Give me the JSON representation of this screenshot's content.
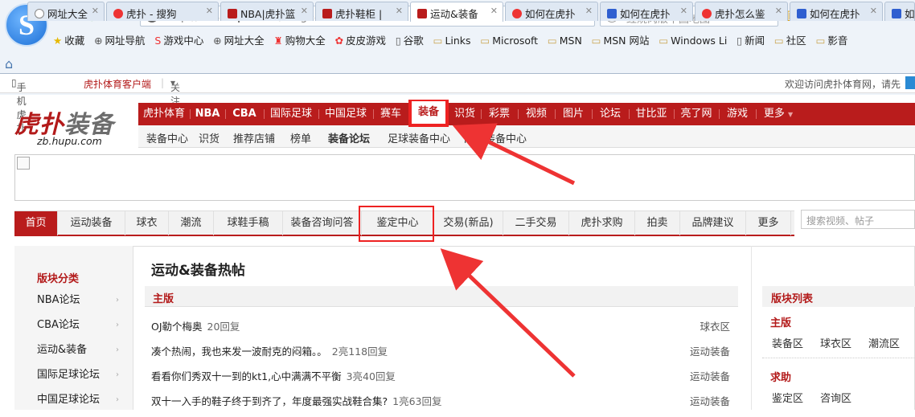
{
  "browser": {
    "url_prefix": "http://",
    "url_domain": "bbs.hupu.com",
    "url_path": "/all-gear",
    "search_placeholder": "红烧肉版中国地图",
    "bookmarks": [
      "收藏",
      "网址导航",
      "游戏中心",
      "网址大全",
      "购物大全",
      "皮皮游戏",
      "谷歌",
      "Links",
      "Microsoft",
      "MSN",
      "MSN 网站",
      "Windows Li",
      "新闻",
      "社区",
      "影音"
    ],
    "tabs": [
      "网址大全",
      "虎扑 - 搜狗",
      "NBA|虎扑篮",
      "虎扑鞋柜 |",
      "运动&装备",
      "如何在虎扑",
      "如何在虎扑",
      "虎扑怎么鉴",
      "如何在虎扑",
      "如何"
    ]
  },
  "sitebar": {
    "mobile": "手机虎扑",
    "client": "虎扑体育客户端",
    "follow": "关注虎扑",
    "welcome": "欢迎访问虎扑体育网，请先"
  },
  "header": {
    "logo_main": "虎扑",
    "logo_sub": "装备",
    "logo_domain": "zb.hupu.com",
    "main_nav": [
      "虎扑体育",
      "NBA",
      "CBA",
      "国际足球",
      "中国足球",
      "赛车",
      "装备",
      "识货",
      "彩票",
      "视频",
      "图片",
      "论坛",
      "甘比亚",
      "亮了网",
      "游戏",
      "更多"
    ],
    "sub_nav": [
      "装备中心",
      "识货",
      "推荐店铺",
      "榜单",
      "装备论坛",
      "足球装备中心",
      "网球装备中心"
    ]
  },
  "forum_nav": {
    "items": [
      "首页",
      "运动装备",
      "球衣",
      "潮流",
      "球鞋手稿",
      "装备咨询问答",
      "鉴定中心",
      "交易(新品)",
      "二手交易",
      "虎扑求购",
      "拍卖",
      "品牌建议",
      "更多"
    ],
    "search_placeholder": "搜索视频、帖子"
  },
  "left": {
    "title": "版块分类",
    "items": [
      "NBA论坛",
      "CBA论坛",
      "运动&装备",
      "国际足球论坛",
      "中国足球论坛"
    ]
  },
  "main": {
    "title": "运动&装备热帖",
    "section": "主版",
    "posts": [
      {
        "title": "OJ勒个梅奥",
        "replies": "20回复",
        "cat": "球衣区"
      },
      {
        "title": "凑个热闹，我也来发一波耐克的闷箱。。",
        "replies": "2亮118回复",
        "cat": "运动装备"
      },
      {
        "title": "看看你们秀双十一到的kt1,心中满满不平衡",
        "replies": "3亮40回复",
        "cat": "运动装备"
      },
      {
        "title": "双十一入手的鞋子终于到齐了，年度最强实战鞋合集?",
        "replies": "1亮63回复",
        "cat": "运动装备"
      }
    ]
  },
  "right": {
    "title": "版块列表",
    "sec1": "主版",
    "sec1_links": [
      "装备区",
      "球衣区",
      "潮流区"
    ],
    "sec2": "求助",
    "sec2_links": [
      "鉴定区",
      "咨询区"
    ]
  }
}
